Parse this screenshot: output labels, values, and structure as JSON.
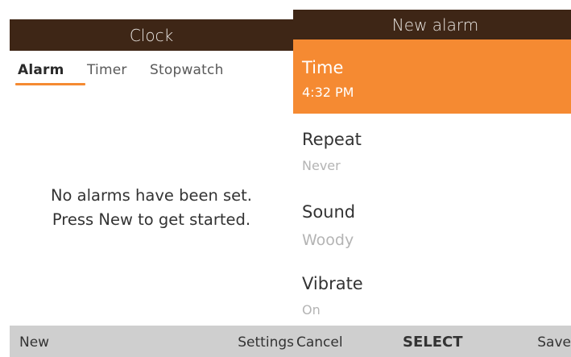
{
  "clock": {
    "title": "Clock",
    "tabs": [
      {
        "label": "Alarm",
        "active": true
      },
      {
        "label": "Timer",
        "active": false
      },
      {
        "label": "Stopwatch",
        "active": false
      }
    ],
    "empty_message": {
      "line1": "No alarms have been set.",
      "line2": "Press New to get started."
    },
    "softkeys": {
      "left": "New",
      "center": "",
      "right": "Settings"
    }
  },
  "new_alarm": {
    "title": "New alarm",
    "rows": [
      {
        "label": "Time",
        "value": "4:32 PM",
        "selected": true
      },
      {
        "label": "Repeat",
        "value": "Never",
        "selected": false
      },
      {
        "label": "Sound",
        "value": "Woody",
        "selected": false
      },
      {
        "label": "Vibrate",
        "value": "On",
        "selected": false
      }
    ],
    "softkeys": {
      "left": "Cancel",
      "center": "SELECT",
      "right": "Save"
    }
  },
  "colors": {
    "titlebar": "#3e2616",
    "accent": "#f58a32",
    "softkey_bar": "#cfcfcf",
    "secondary_text": "#b4b4b4"
  }
}
